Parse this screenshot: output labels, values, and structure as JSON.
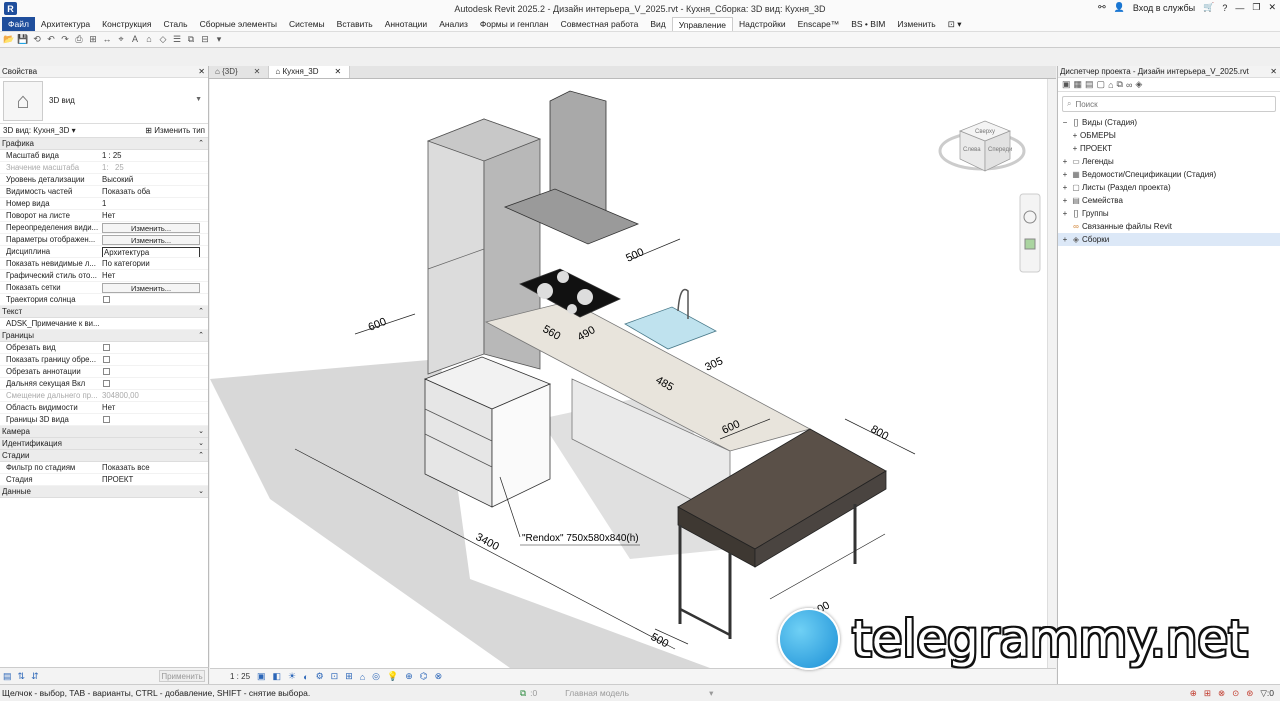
{
  "title": {
    "app_letter": "R",
    "text": "Autodesk Revit 2025.2 - Дизайн интерьера_V_2025.rvt - Кухня_Сборка: 3D вид: Кухня_3D",
    "login": "Вход в службы",
    "help": "?"
  },
  "ribbon": {
    "tabs": [
      "Файл",
      "Архитектура",
      "Конструкция",
      "Сталь",
      "Сборные элементы",
      "Системы",
      "Вставить",
      "Аннотации",
      "Анализ",
      "Формы и генплан",
      "Совместная работа",
      "Вид",
      "Управление",
      "Надстройки",
      "Enscape™",
      "BS • BIM",
      "Изменить"
    ],
    "active": "Управление"
  },
  "properties": {
    "header": "Свойства",
    "type_name": "3D вид",
    "view_selector": "3D вид: Кухня_3D",
    "edit_type": "Изменить тип",
    "sections": {
      "graphics": "Графика",
      "text": "Текст",
      "extents": "Границы",
      "camera": "Камера",
      "identity": "Идентификация",
      "phasing": "Стадии",
      "data": "Данные"
    },
    "rows": {
      "scale_k": "Масштаб вида",
      "scale_v": "1 : 25",
      "scale_val_k": "Значение масштаба",
      "scale_val_v1": "1:",
      "scale_val_v2": "25",
      "detail_k": "Уровень детализации",
      "detail_v": "Высокий",
      "parts_k": "Видимость частей",
      "parts_v": "Показать оба",
      "viewnum_k": "Номер вида",
      "viewnum_v": "1",
      "rotation_k": "Поворот на листе",
      "rotation_v": "Нет",
      "overrides_k": "Переопределения види...",
      "overrides_v": "Изменить...",
      "display_k": "Параметры отображен...",
      "display_v": "Изменить...",
      "discipline_k": "Дисциплина",
      "discipline_v": "Архитектура",
      "hidden_k": "Показать невидимые л...",
      "hidden_v": "По категории",
      "style_k": "Графический стиль ото...",
      "style_v": "Нет",
      "grids_k": "Показать сетки",
      "grids_v": "Изменить...",
      "sun_k": "Траектория солнца",
      "note_k": "ADSK_Примечание к ви...",
      "crop_k": "Обрезать вид",
      "cropshow_k": "Показать границу обре...",
      "cropann_k": "Обрезать аннотации",
      "farclip_k": "Дальняя секущая Вкл",
      "faroffset_k": "Смещение дальнего пр...",
      "faroffset_v": "304800,00",
      "scopebox_k": "Область видимости",
      "scopebox_v": "Нет",
      "box3d_k": "Границы 3D вида",
      "phasefilter_k": "Фильтр по стадиям",
      "phasefilter_v": "Показать все",
      "phase_k": "Стадия",
      "phase_v": "ПРОЕКТ"
    },
    "apply": "Применить"
  },
  "view_tabs": [
    {
      "label": "{3D}"
    },
    {
      "label": "Кухня_3D"
    }
  ],
  "viewport": {
    "dims": {
      "d500a": "500",
      "d600a": "600",
      "d560": "560",
      "d490": "490",
      "d305": "305",
      "d485": "485",
      "d600b": "600",
      "d800": "800",
      "d3400": "3400",
      "d500b": "500",
      "d1100": "1100"
    },
    "tag": "\"Rendox\" 750x580x840(h)",
    "viewcube": {
      "top": "Сверху",
      "left": "Слева",
      "front": "Спереди"
    }
  },
  "viewbar": {
    "scale": "1 : 25"
  },
  "browser": {
    "header": "Диспетчер проекта - Дизайн интерьера_V_2025.rvt",
    "search_placeholder": "Поиск",
    "tree": [
      {
        "label": "Виды (Стадия)",
        "tog": "−",
        "icon": "[]",
        "level": 0
      },
      {
        "label": "ОБМЕРЫ",
        "tog": "+",
        "icon": "",
        "level": 1
      },
      {
        "label": "ПРОЕКТ",
        "tog": "+",
        "icon": "",
        "level": 1
      },
      {
        "label": "Легенды",
        "tog": "+",
        "icon": "▭",
        "level": 0
      },
      {
        "label": "Ведомости/Спецификации (Стадия)",
        "tog": "+",
        "icon": "▦",
        "level": 0
      },
      {
        "label": "Листы (Раздел проекта)",
        "tog": "+",
        "icon": "▢",
        "level": 0
      },
      {
        "label": "Семейства",
        "tog": "+",
        "icon": "▤",
        "level": 0
      },
      {
        "label": "Группы",
        "tog": "+",
        "icon": "[]",
        "level": 0
      },
      {
        "label": "Связанные файлы Revit",
        "tog": "",
        "icon": "∞",
        "level": 0
      },
      {
        "label": "Сборки",
        "tog": "+",
        "icon": "◈",
        "level": 0
      }
    ]
  },
  "status": {
    "hint": "Щелчок - выбор, TAB - варианты, CTRL - добавление, SHIFT - снятие выбора.",
    "zero1": ":0",
    "model": "Главная модель",
    "zero2": ":0"
  },
  "watermark": "telegrammy.net",
  "colors": {
    "accent": "#1f4e9c",
    "counter": "#5a5048",
    "sink": "#bfe2ee"
  }
}
